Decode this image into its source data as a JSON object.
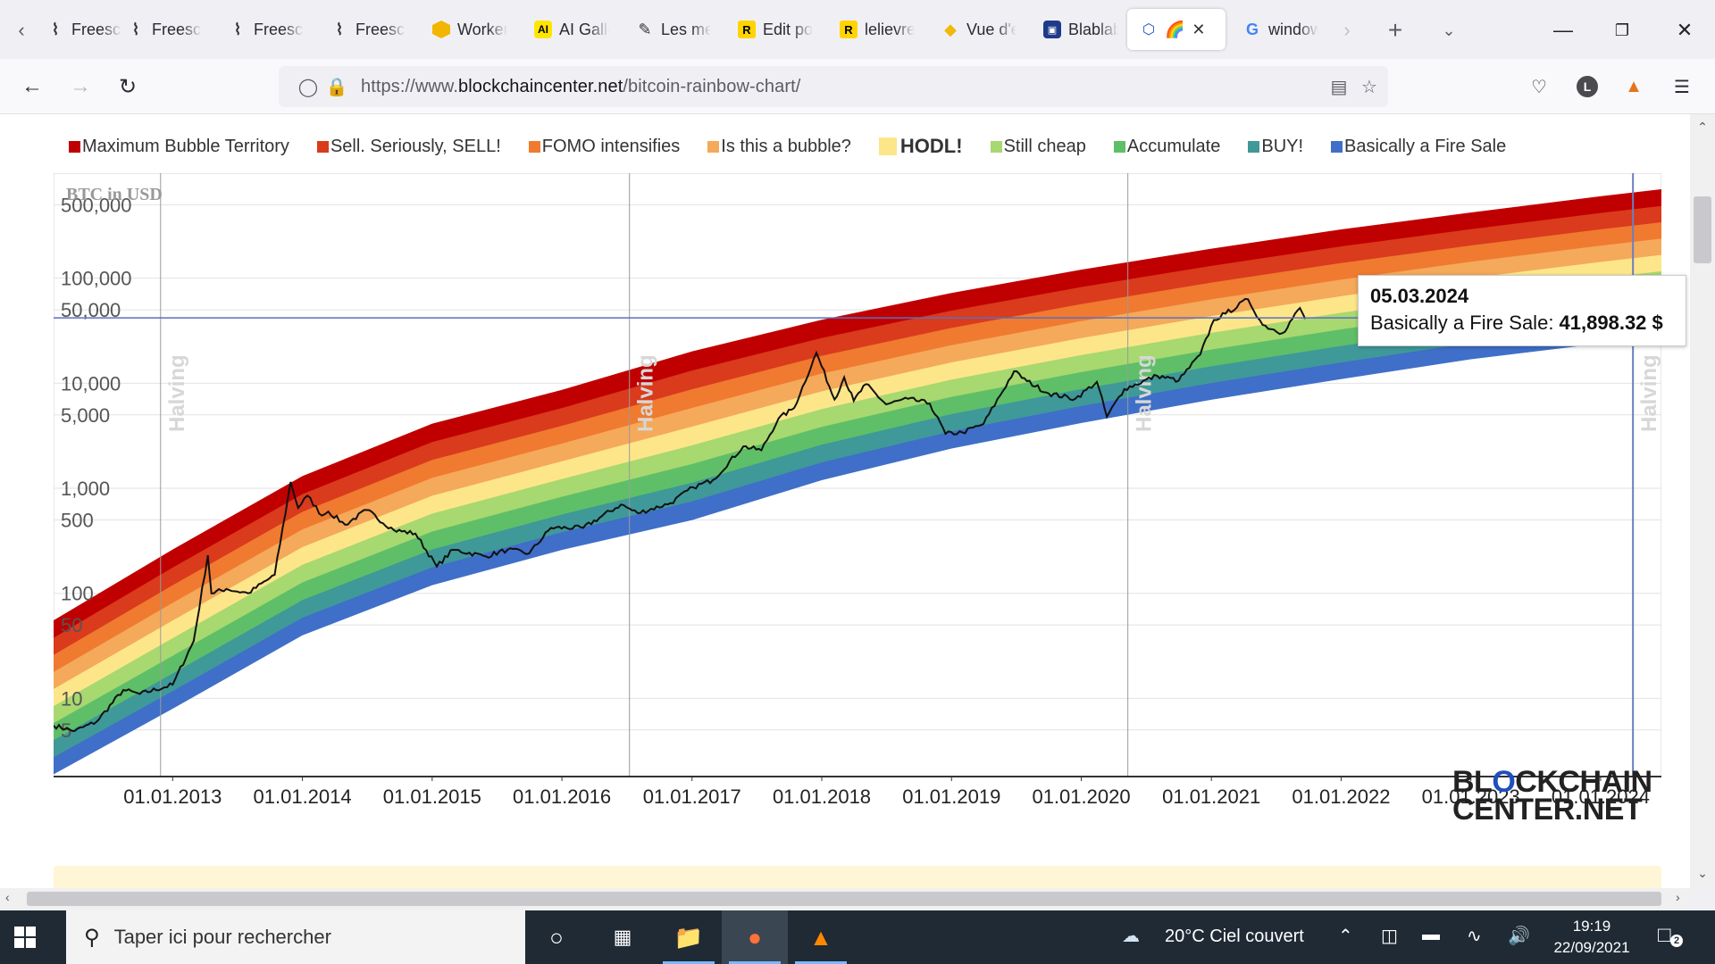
{
  "browser": {
    "tabs": [
      {
        "label": "Freescout",
        "icon": "waveform-icon",
        "active": false
      },
      {
        "label": "Freescout",
        "icon": "waveform-icon",
        "active": false
      },
      {
        "label": "Freescout",
        "icon": "waveform-icon",
        "active": false
      },
      {
        "label": "Freescout",
        "icon": "waveform-icon",
        "active": false
      },
      {
        "label": "Workers",
        "icon": "hexagon-icon",
        "active": false
      },
      {
        "label": "AI Gallery",
        "icon": "ai-icon",
        "active": false
      },
      {
        "label": "Les meilleurs",
        "icon": "pen-icon",
        "active": false
      },
      {
        "label": "Edit post",
        "icon": "r-icon",
        "active": false
      },
      {
        "label": "lelievre",
        "icon": "r-icon",
        "active": false
      },
      {
        "label": "Vue d'ensemble",
        "icon": "binance-icon",
        "active": false
      },
      {
        "label": "Blablabla",
        "icon": "blabla-icon",
        "active": false
      },
      {
        "label": "",
        "icon": "blockchaincenter-icon",
        "active": true
      },
      {
        "label": "windows",
        "icon": "google-icon",
        "active": false
      }
    ],
    "url_prefix": "https://www.",
    "url_domain": "blockchaincenter.net",
    "url_path": "/bitcoin-rainbow-chart/"
  },
  "legend": [
    {
      "label": "Maximum Bubble Territory",
      "color": "#c00000"
    },
    {
      "label": "Sell. Seriously, SELL!",
      "color": "#d93b1c"
    },
    {
      "label": "FOMO intensifies",
      "color": "#f07a30"
    },
    {
      "label": "Is this a bubble?",
      "color": "#f5a95a"
    },
    {
      "label": "HODL!",
      "color": "#fde68a"
    },
    {
      "label": "Still cheap",
      "color": "#a8d870"
    },
    {
      "label": "Accumulate",
      "color": "#5fbf68"
    },
    {
      "label": "BUY!",
      "color": "#3f9998"
    },
    {
      "label": "Basically a Fire Sale",
      "color": "#3f6fc8"
    }
  ],
  "chart_data": {
    "type": "area",
    "title": "",
    "ylabel": "BTC in USD",
    "y_scale": "log",
    "ylim": [
      1.8,
      1000000
    ],
    "xlim": [
      "2012-02-01",
      "2024-06-20"
    ],
    "y_ticks": [
      {
        "label": "500,000",
        "value": 500000
      },
      {
        "label": "100,000",
        "value": 100000
      },
      {
        "label": "50,000",
        "value": 50000
      },
      {
        "label": "10,000",
        "value": 10000
      },
      {
        "label": "5,000",
        "value": 5000
      },
      {
        "label": "1,000",
        "value": 1000
      },
      {
        "label": "500",
        "value": 500
      },
      {
        "label": "100",
        "value": 100
      },
      {
        "label": "50",
        "value": 50
      },
      {
        "label": "10",
        "value": 10
      },
      {
        "label": "5",
        "value": 5
      }
    ],
    "x_ticks": [
      {
        "label": "01.01.2013",
        "date": "2013-01-01"
      },
      {
        "label": "01.01.2014",
        "date": "2014-01-01"
      },
      {
        "label": "01.01.2015",
        "date": "2015-01-01"
      },
      {
        "label": "01.01.2016",
        "date": "2016-01-01"
      },
      {
        "label": "01.01.2017",
        "date": "2017-01-01"
      },
      {
        "label": "01.01.2018",
        "date": "2018-01-01"
      },
      {
        "label": "01.01.2019",
        "date": "2019-01-01"
      },
      {
        "label": "01.01.2020",
        "date": "2020-01-01"
      },
      {
        "label": "01.01.2021",
        "date": "2021-01-01"
      },
      {
        "label": "01.01.2022",
        "date": "2022-01-01"
      },
      {
        "label": "01.01.2023",
        "date": "2023-01-01"
      },
      {
        "label": "01.01.2024",
        "date": "2024-01-01"
      }
    ],
    "halvings": [
      {
        "label": "Halving",
        "date": "2012-11-28"
      },
      {
        "label": "Halving",
        "date": "2016-07-09"
      },
      {
        "label": "Halving",
        "date": "2020-05-11"
      },
      {
        "label": "Halving",
        "date": "2024-04-01"
      }
    ],
    "bands": {
      "x": [
        "2012-02-01",
        "2013-01-01",
        "2014-01-01",
        "2015-01-01",
        "2016-01-01",
        "2017-01-01",
        "2018-01-01",
        "2019-01-01",
        "2020-01-01",
        "2021-01-01",
        "2022-01-01",
        "2023-01-01",
        "2024-01-01",
        "2024-06-20"
      ],
      "bottom": [
        1.9,
        8,
        40,
        120,
        260,
        500,
        1200,
        2400,
        4200,
        7000,
        11000,
        17000,
        24000,
        28000
      ],
      "top": [
        55,
        260,
        1300,
        4100,
        8600,
        20000,
        40000,
        72000,
        120000,
        190000,
        290000,
        420000,
        600000,
        700000
      ]
    },
    "series": [
      {
        "name": "",
        "x": [
          "2012-02-01",
          "2012-04-01",
          "2012-06-01",
          "2012-08-15",
          "2012-10-01",
          "2013-01-01",
          "2013-03-01",
          "2013-04-10",
          "2013-04-20",
          "2013-06-01",
          "2013-08-01",
          "2013-10-15",
          "2013-11-29",
          "2013-12-20",
          "2014-01-15",
          "2014-02-25",
          "2014-03-15",
          "2014-05-01",
          "2014-07-01",
          "2014-09-15",
          "2014-11-15",
          "2015-01-14",
          "2015-03-01",
          "2015-06-01",
          "2015-08-01",
          "2015-10-01",
          "2015-12-01",
          "2016-03-01",
          "2016-06-15",
          "2016-08-01",
          "2016-11-01",
          "2017-01-04",
          "2017-03-01",
          "2017-05-25",
          "2017-07-15",
          "2017-09-01",
          "2017-10-15",
          "2017-12-17",
          "2018-02-06",
          "2018-03-05",
          "2018-04-01",
          "2018-05-05",
          "2018-07-01",
          "2018-09-01",
          "2018-11-01",
          "2018-12-15",
          "2019-02-01",
          "2019-04-01",
          "2019-06-26",
          "2019-08-01",
          "2019-10-01",
          "2019-12-15",
          "2020-02-14",
          "2020-03-13",
          "2020-05-01",
          "2020-08-01",
          "2020-10-01",
          "2020-12-01",
          "2021-01-08",
          "2021-02-10",
          "2021-04-14",
          "2021-05-25",
          "2021-07-20",
          "2021-09-07",
          "2021-09-22"
        ],
        "values": [
          5.5,
          4.9,
          6,
          12,
          11,
          13.5,
          35,
          230,
          100,
          110,
          100,
          150,
          1150,
          650,
          850,
          550,
          600,
          450,
          620,
          400,
          370,
          180,
          260,
          225,
          260,
          240,
          420,
          420,
          700,
          580,
          720,
          1020,
          1200,
          2500,
          2300,
          4600,
          5800,
          19500,
          7000,
          11400,
          6800,
          9800,
          6300,
          7100,
          6400,
          3300,
          3400,
          4100,
          13000,
          10500,
          8000,
          7100,
          10300,
          4800,
          8800,
          11800,
          10600,
          18800,
          40000,
          46000,
          63000,
          36000,
          30000,
          52000,
          41000
        ]
      }
    ],
    "tooltip": {
      "date": "05.03.2024",
      "label": "Basically a Fire Sale",
      "value": "41,898.32 $",
      "y": 41898.32
    }
  },
  "logo": {
    "line1_a": "BL",
    "line1_o": "O",
    "line1_b": "CKCHAIN",
    "line2": "CENTER.NET"
  },
  "taskbar": {
    "search_placeholder": "Taper ici pour rechercher",
    "weather": "20°C  Ciel couvert",
    "time": "19:19",
    "date": "22/09/2021",
    "notifications": "2"
  }
}
